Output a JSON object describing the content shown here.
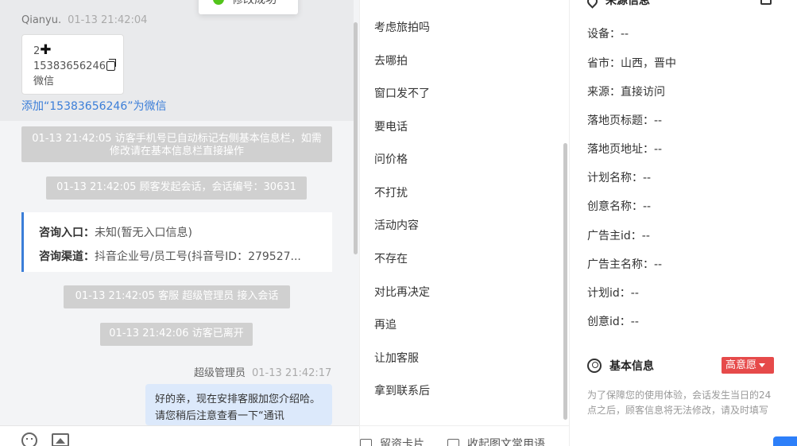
{
  "toast": {
    "text": "修改成功"
  },
  "chat": {
    "visitor": {
      "name": "Qianyu.",
      "time": "01-13 21:42:04"
    },
    "contact_card": {
      "line1": "2",
      "phone": "15383656246",
      "label": "微信"
    },
    "add_link": "添加“15383656246”为微信",
    "sys_messages": [
      "01-13 21:42:05 访客手机号已自动标记右侧基本信息栏，如需修改请在基本信息栏直接操作",
      "01-13 21:42:05 顾客发起会话，会话编号：30631",
      "01-13 21:42:05 客服 超级管理员 接入会话",
      "01-13 21:42:06 访客已离开"
    ],
    "consult": {
      "entry_label": "咨询入口：",
      "entry_value": "未知(暂无入口信息)",
      "channel_label": "咨询渠道：",
      "channel_value": "抖音企业号/员工号(抖音号ID：279527..."
    },
    "agent": {
      "name": "超级管理员",
      "time": "01-13 21:42:17"
    },
    "agent_message": "好的亲，现在安排客服加您介绍哈。请您稍后注意查看一下“通讯"
  },
  "quick_replies": [
    "考虑旅拍吗",
    "去哪拍",
    "窗口发不了",
    "要电话",
    "问价格",
    "不打扰",
    "活动内容",
    "不存在",
    "对比再决定",
    "再追",
    "让加客服",
    "拿到联系后"
  ],
  "quick_bottom": {
    "card": "留资卡片",
    "collapse": "收起图文常用语"
  },
  "info": {
    "source_title": "来源信息",
    "rows": [
      "设备：--",
      "省市：山西，晋中",
      "来源：直接访问",
      "落地页标题：--",
      "落地页地址：--",
      "计划名称：--",
      "创意名称：--",
      "广告主id：--",
      "广告主名称：--",
      "计划id：--",
      "创意id：--"
    ],
    "basic_title": "基本信息",
    "intent": "高意愿",
    "notice": "为了保障您的使用体验，会话发生当日的24点之后，顾客信息将无法修改，请及时填写"
  }
}
